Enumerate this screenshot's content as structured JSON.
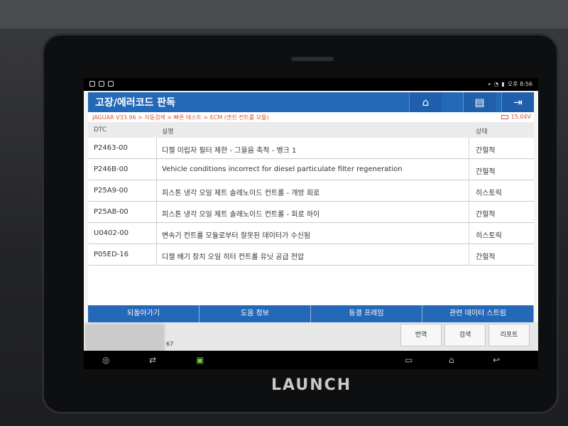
{
  "status_bar": {
    "time": "오후 8:56"
  },
  "header": {
    "title": "고장/에러코드 판독",
    "home_icon": "home-icon",
    "print_icon": "printer-icon",
    "exit_icon": "exit-icon"
  },
  "breadcrumb": {
    "path": "JAGUAR V33.96 > 자동검색 > 빠른 테스트 > ECM (엔진 컨트롤 모듈)",
    "voltage": "15.04V"
  },
  "table": {
    "columns": [
      "DTC",
      "설명",
      "상태"
    ],
    "rows": [
      {
        "code": "P2463-00",
        "description": "디젤 미립자 필터 제한 - 그을음 축적 - 뱅크 1",
        "status": "간헐적"
      },
      {
        "code": "P246B-00",
        "description": "Vehicle conditions incorrect for diesel particulate filter regeneration",
        "status": "간헐적"
      },
      {
        "code": "P25A9-00",
        "description": "피스톤 냉각 오일 제트 솔레노이드 컨트롤 - 개방 회로",
        "status": "히스토릭"
      },
      {
        "code": "P25AB-00",
        "description": "피스톤 냉각 오일 제트 솔레노이드 컨트롤 - 회로 하이",
        "status": "간헐적"
      },
      {
        "code": "U0402-00",
        "description": "변속기 컨트롤 모듈로부터 잘못된 데이터가 수신됨",
        "status": "히스토릭"
      },
      {
        "code": "P05ED-16",
        "description": "디젤 배기 장치 오일 히터 컨트롤 유닛 공급 전압",
        "status": "간헐적"
      }
    ]
  },
  "actions": {
    "back": "되돌아가기",
    "help": "도움 정보",
    "freeze": "동결 프레임",
    "related": "관련 데이터 스트림"
  },
  "bottom": {
    "vin_suffix": "67",
    "translate": "번역",
    "search": "검색",
    "report": "리포트"
  },
  "device": {
    "brand": "LAUNCH"
  },
  "colors": {
    "header_blue": "#2468b8",
    "breadcrumb_orange": "#e0542a"
  }
}
